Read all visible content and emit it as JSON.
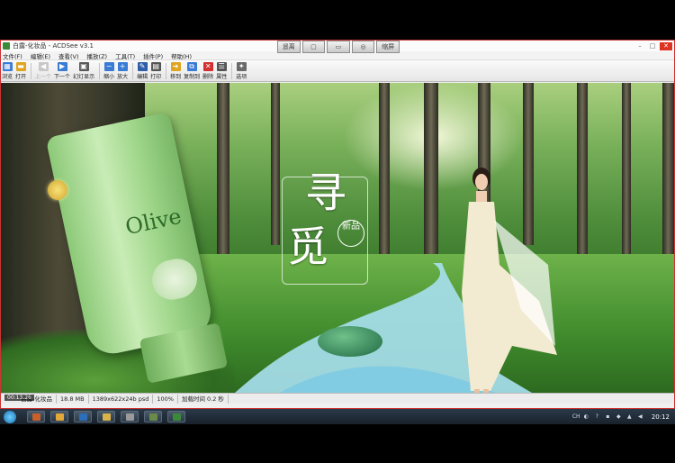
{
  "window": {
    "title": "白露-化妆品 - ACDSee v3.1"
  },
  "float_controls": [
    "遥离",
    "",
    "",
    "",
    "缩屏"
  ],
  "menu": [
    "文件(F)",
    "编辑(E)",
    "查看(V)",
    "播放(Z)",
    "工具(T)",
    "插件(P)",
    "帮助(H)"
  ],
  "toolbar": [
    {
      "label": "浏览",
      "icon": "browse-icon",
      "color": "#3a7bd5",
      "enabled": true
    },
    {
      "label": "打开",
      "icon": "open-folder-icon",
      "color": "#e0a520",
      "enabled": true
    },
    {
      "label": "上一个",
      "icon": "previous-icon",
      "color": "#b0b0b0",
      "enabled": false
    },
    {
      "label": "下一个",
      "icon": "next-icon",
      "color": "#3a7bd5",
      "enabled": true
    },
    {
      "label": "幻灯显示",
      "icon": "slideshow-icon",
      "color": "#5a5a5a",
      "enabled": true
    },
    {
      "label": "缩小",
      "icon": "zoom-out-icon",
      "color": "#3a7bd5",
      "enabled": true
    },
    {
      "label": "放大",
      "icon": "zoom-in-icon",
      "color": "#3a7bd5",
      "enabled": true
    },
    {
      "label": "编辑",
      "icon": "edit-icon",
      "color": "#2e5ea8",
      "enabled": true
    },
    {
      "label": "打印",
      "icon": "print-icon",
      "color": "#555555",
      "enabled": true
    },
    {
      "label": "移到",
      "icon": "move-icon",
      "color": "#e0a520",
      "enabled": true
    },
    {
      "label": "复制到",
      "icon": "copy-icon",
      "color": "#3a7bd5",
      "enabled": true
    },
    {
      "label": "删除",
      "icon": "delete-icon",
      "color": "#d32f2f",
      "enabled": true
    },
    {
      "label": "属性",
      "icon": "properties-icon",
      "color": "#555555",
      "enabled": true
    },
    {
      "label": "选项",
      "icon": "options-icon",
      "color": "#6a6a6a",
      "enabled": true
    }
  ],
  "image": {
    "brand": "Olive",
    "slogan_big_1": "寻",
    "slogan_big_2": "觅",
    "slogan_small": "新品"
  },
  "statusbar": {
    "overlay_time": "00:13:26",
    "filename": "白露-化妆品",
    "size": "18.8 MB",
    "dims": "1389x622x24b psd",
    "zoom": "100%",
    "load_time": "加载时间 0.2 秒"
  },
  "taskbar": {
    "clock": "20:12"
  },
  "colors": {
    "window_border": "#cc3333",
    "taskbar": "#1f2b36"
  }
}
